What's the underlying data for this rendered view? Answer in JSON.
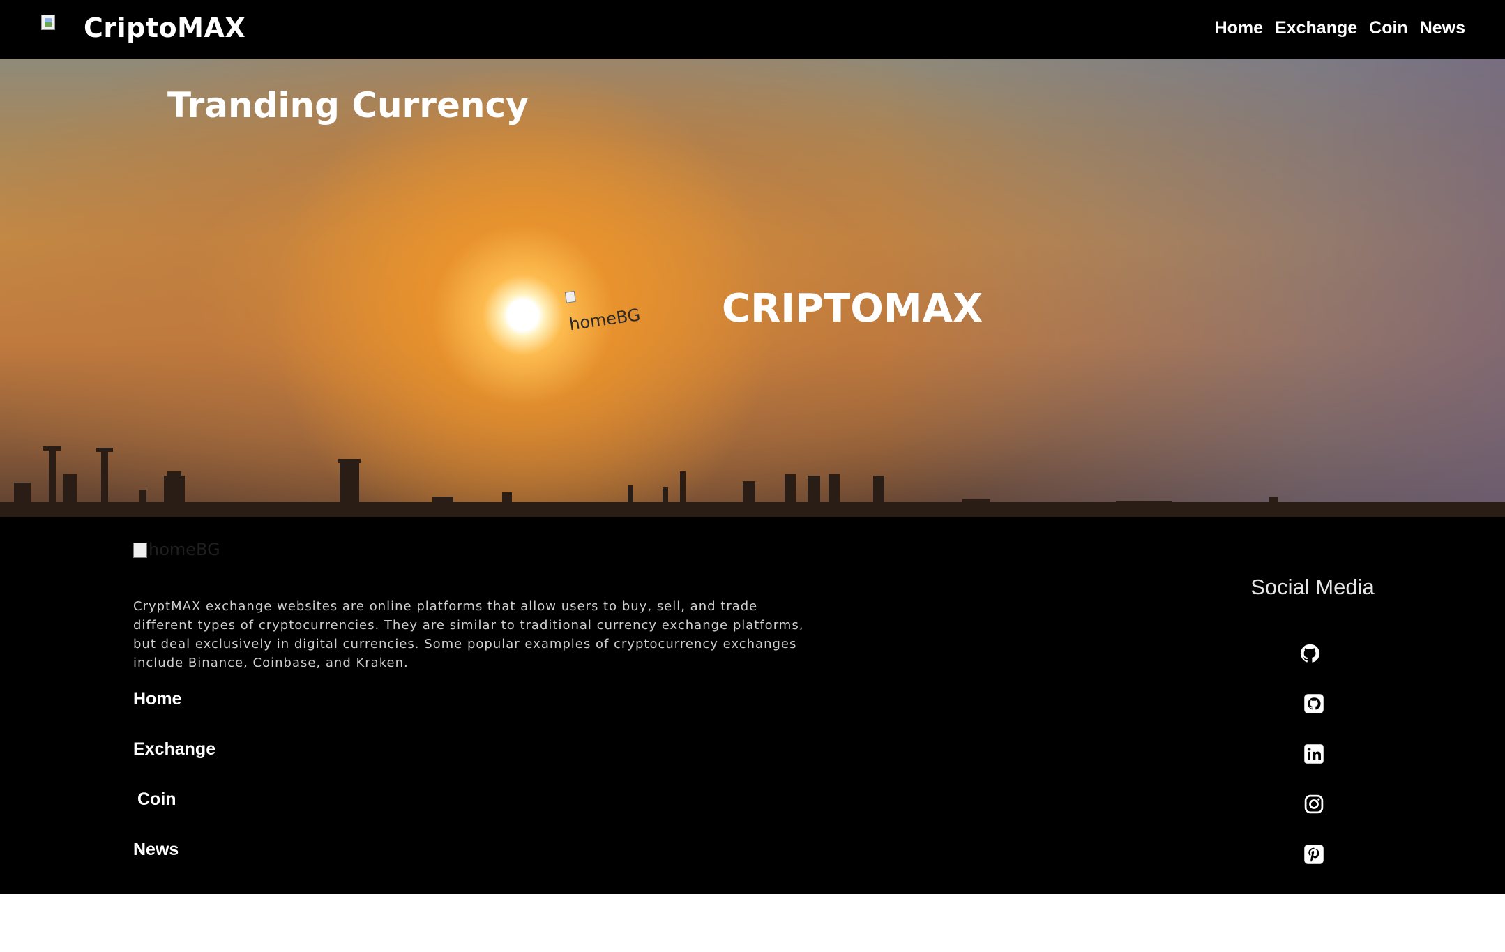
{
  "navbar": {
    "logo_icon": "broken-image-icon",
    "brand": "CriptoMAX",
    "links": [
      "Home",
      "Exchange",
      "Coin",
      "News"
    ]
  },
  "hero": {
    "title": "Tranding Currency",
    "image_alt": "homeBG",
    "brand": "CRIPTOMAX"
  },
  "footer": {
    "logo_alt": "homeBG",
    "description": "CryptMAX exchange websites are online platforms that allow users to buy, sell, and trade different types of cryptocurrencies. They are similar to traditional currency exchange platforms, but deal exclusively in digital currencies. Some popular examples of cryptocurrency exchanges include Binance, Coinbase, and Kraken.",
    "links": [
      "Home",
      "Exchange",
      "Coin",
      "News"
    ],
    "social_title": "Social Media",
    "social_icons": [
      "github-icon",
      "github-square-icon",
      "linkedin-icon",
      "instagram-icon",
      "pinterest-icon"
    ]
  },
  "colors": {
    "navbar_bg": "#000000",
    "footer_bg": "#000000",
    "text_primary": "#ffffff",
    "text_muted": "#cfcfcf"
  }
}
